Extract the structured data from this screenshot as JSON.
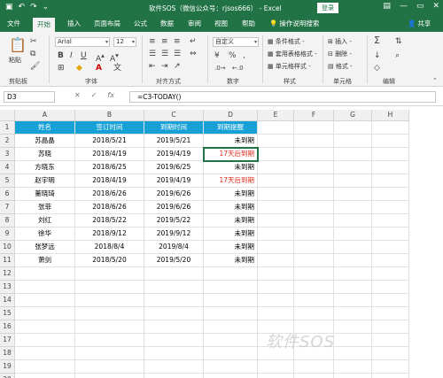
{
  "titlebar": {
    "title": "软件SOS（微信公众号：rjsos666）  -  Excel",
    "login_label": "登录",
    "minimize": "—",
    "restore": "▭",
    "close": "✕"
  },
  "tabs": [
    {
      "label": "文件"
    },
    {
      "label": "开始"
    },
    {
      "label": "插入"
    },
    {
      "label": "页面布局"
    },
    {
      "label": "公式"
    },
    {
      "label": "数据"
    },
    {
      "label": "审阅"
    },
    {
      "label": "视图"
    },
    {
      "label": "帮助"
    },
    {
      "label": "操作说明搜索"
    },
    {
      "label": "共享"
    }
  ],
  "ribbon": {
    "paste_label": "粘贴",
    "font_name": "Arial",
    "font_size": "12",
    "number_format": "自定义",
    "styles": [
      "条件格式 -",
      "套用表格格式 -",
      "单元格样式 -"
    ],
    "cells": [
      "插入 -",
      "删除 -",
      "格式 -"
    ],
    "groups": [
      "剪贴板",
      "字体",
      "对齐方式",
      "数字",
      "样式",
      "单元格",
      "编辑"
    ]
  },
  "formula_bar": {
    "name_box": "D3",
    "cancel": "✕",
    "enter": "✓",
    "fx": "fx",
    "formula": "=C3-TODAY()"
  },
  "sheet": {
    "columns": [
      "A",
      "B",
      "C",
      "D",
      "E",
      "F",
      "G",
      "H"
    ],
    "rows": [
      "1",
      "2",
      "3",
      "4",
      "5",
      "6",
      "7",
      "8",
      "9",
      "10",
      "11",
      "12",
      "13",
      "14",
      "15",
      "16",
      "17",
      "18",
      "19",
      "20"
    ],
    "headers": [
      "姓名",
      "签订时间",
      "到期时间",
      "到期提醒"
    ],
    "data": [
      [
        "苏晶晶",
        "2018/5/21",
        "2019/5/21",
        "未到期"
      ],
      [
        "苏晓",
        "2018/4/19",
        "2019/4/19",
        "17天后到期"
      ],
      [
        "方晓东",
        "2018/6/25",
        "2019/6/25",
        "未到期"
      ],
      [
        "赵宇明",
        "2018/4/19",
        "2019/4/19",
        "17天后到期"
      ],
      [
        "董晓琦",
        "2018/6/26",
        "2019/6/26",
        "未到期"
      ],
      [
        "张菲",
        "2018/6/26",
        "2019/6/26",
        "未到期"
      ],
      [
        "刘红",
        "2018/5/22",
        "2019/5/22",
        "未到期"
      ],
      [
        "徐华",
        "2018/9/12",
        "2019/9/12",
        "未到期"
      ],
      [
        "张梦远",
        "2018/8/4",
        "2019/8/4",
        "未到期"
      ],
      [
        "萧剑",
        "2018/5/20",
        "2019/5/20",
        "未到期"
      ]
    ],
    "header_color": "#17a1d6",
    "warning_color": "#e02a1c"
  },
  "watermark": "软件SOS"
}
